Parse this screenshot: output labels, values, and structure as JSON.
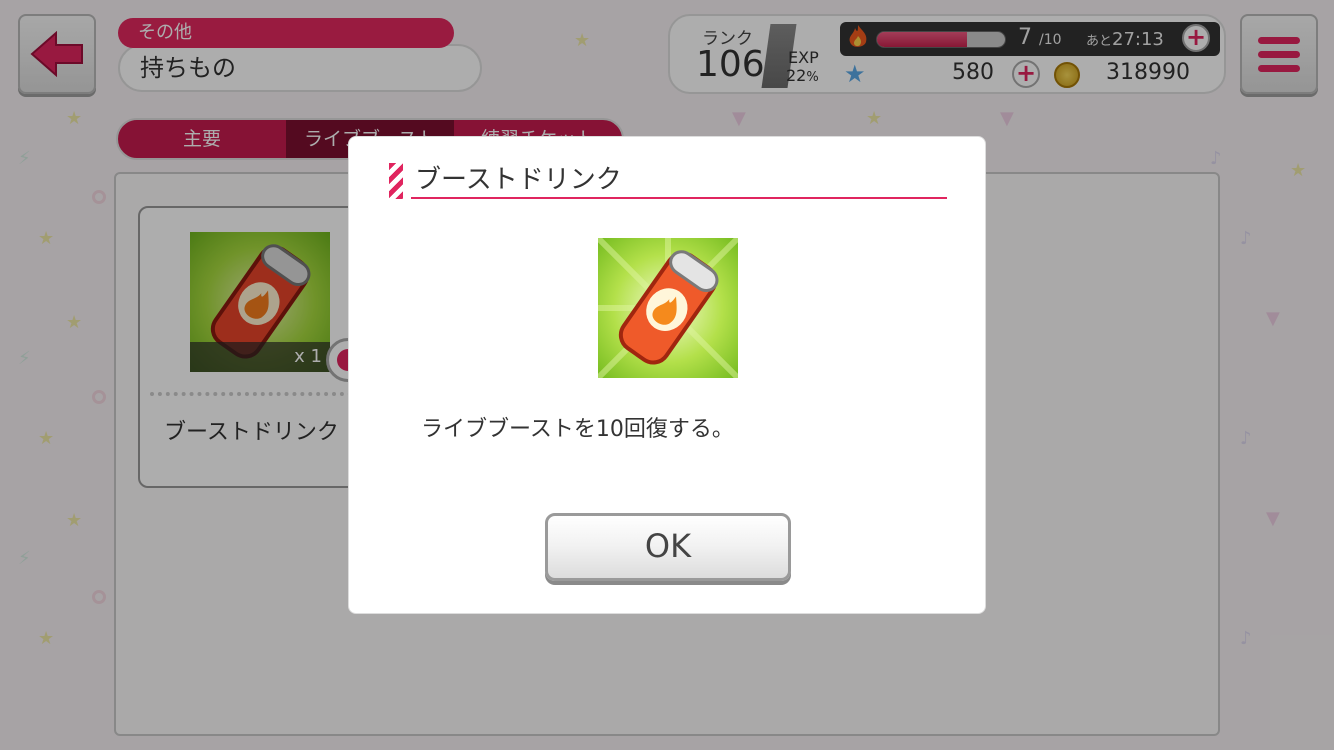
{
  "header": {
    "back_icon": "back-arrow-icon",
    "menu_icon": "hamburger-menu-icon",
    "category": "その他",
    "title": "持ちもの"
  },
  "status": {
    "rank_label": "ランク",
    "rank_value": "106",
    "exp_label": "EXP",
    "exp_value": "22",
    "exp_unit": "%",
    "stamina_icon": "fire-icon",
    "stamina_current": "7",
    "stamina_max": "/10",
    "stamina_fill": 0.7,
    "timer_prefix": "あと",
    "timer_value": "27:13",
    "star_icon": "star-icon",
    "stars_value": "580",
    "coin_icon": "coin-icon",
    "coins_value": "318990",
    "plus_label": "+"
  },
  "tabs": [
    {
      "label": "主要",
      "active": false
    },
    {
      "label": "ライブブースト",
      "active": true
    },
    {
      "label": "練習チケット",
      "active": false
    }
  ],
  "item": {
    "name": "ブーストドリンク",
    "quantity": "x 1",
    "icon": "boost-drink-icon"
  },
  "dialog": {
    "title": "ブーストドリンク",
    "description": "ライブブーストを10回復する。",
    "ok_label": "OK",
    "icon": "boost-drink-icon"
  },
  "colors": {
    "accent": "#e0255f",
    "tab_active": "#7c0f30"
  }
}
